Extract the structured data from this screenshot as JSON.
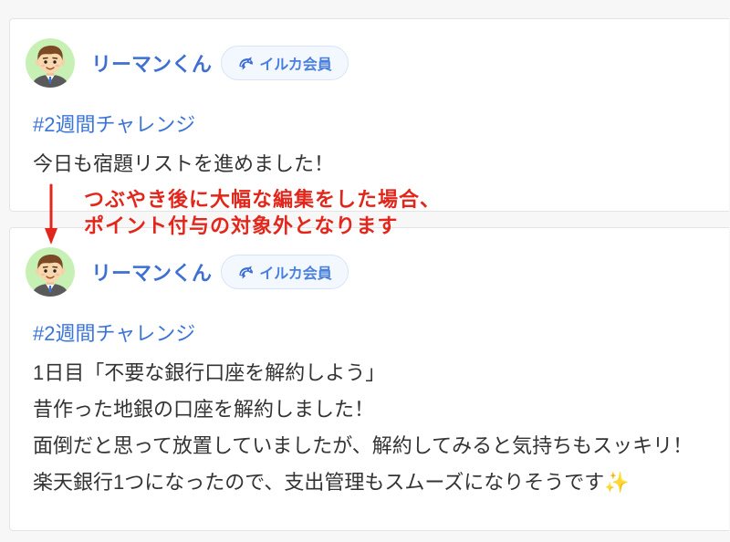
{
  "posts": [
    {
      "user": {
        "name": "リーマンくん",
        "avatar_icon": "salaryman-avatar-icon"
      },
      "badge": {
        "label": "イルカ会員",
        "icon": "dolphin-icon"
      },
      "hashtag": "#2週間チャレンジ",
      "lines": [
        "今日も宿題リストを進めました！"
      ]
    },
    {
      "user": {
        "name": "リーマンくん",
        "avatar_icon": "salaryman-avatar-icon"
      },
      "badge": {
        "label": "イルカ会員",
        "icon": "dolphin-icon"
      },
      "hashtag": "#2週間チャレンジ",
      "lines": [
        "1日目「不要な銀行口座を解約しよう」",
        "昔作った地銀の口座を解約しました！",
        "面倒だと思って放置していましたが、解約してみると気持ちもスッキリ！",
        "楽天銀行1つになったので、支出管理もスムーズになりそうです✨"
      ]
    }
  ],
  "annotation": {
    "lines": [
      "つぶやき後に大幅な編集をした場合、",
      "ポイント付与の対象外となります"
    ],
    "arrow_icon": "down-arrow-icon"
  },
  "colors": {
    "username": "#3d6fd4",
    "hashtag": "#3b74d9",
    "badge_text": "#4a7fdc",
    "annotation": "#e3261b",
    "body_text": "#333333",
    "avatar_background": "#c6f0b4"
  }
}
